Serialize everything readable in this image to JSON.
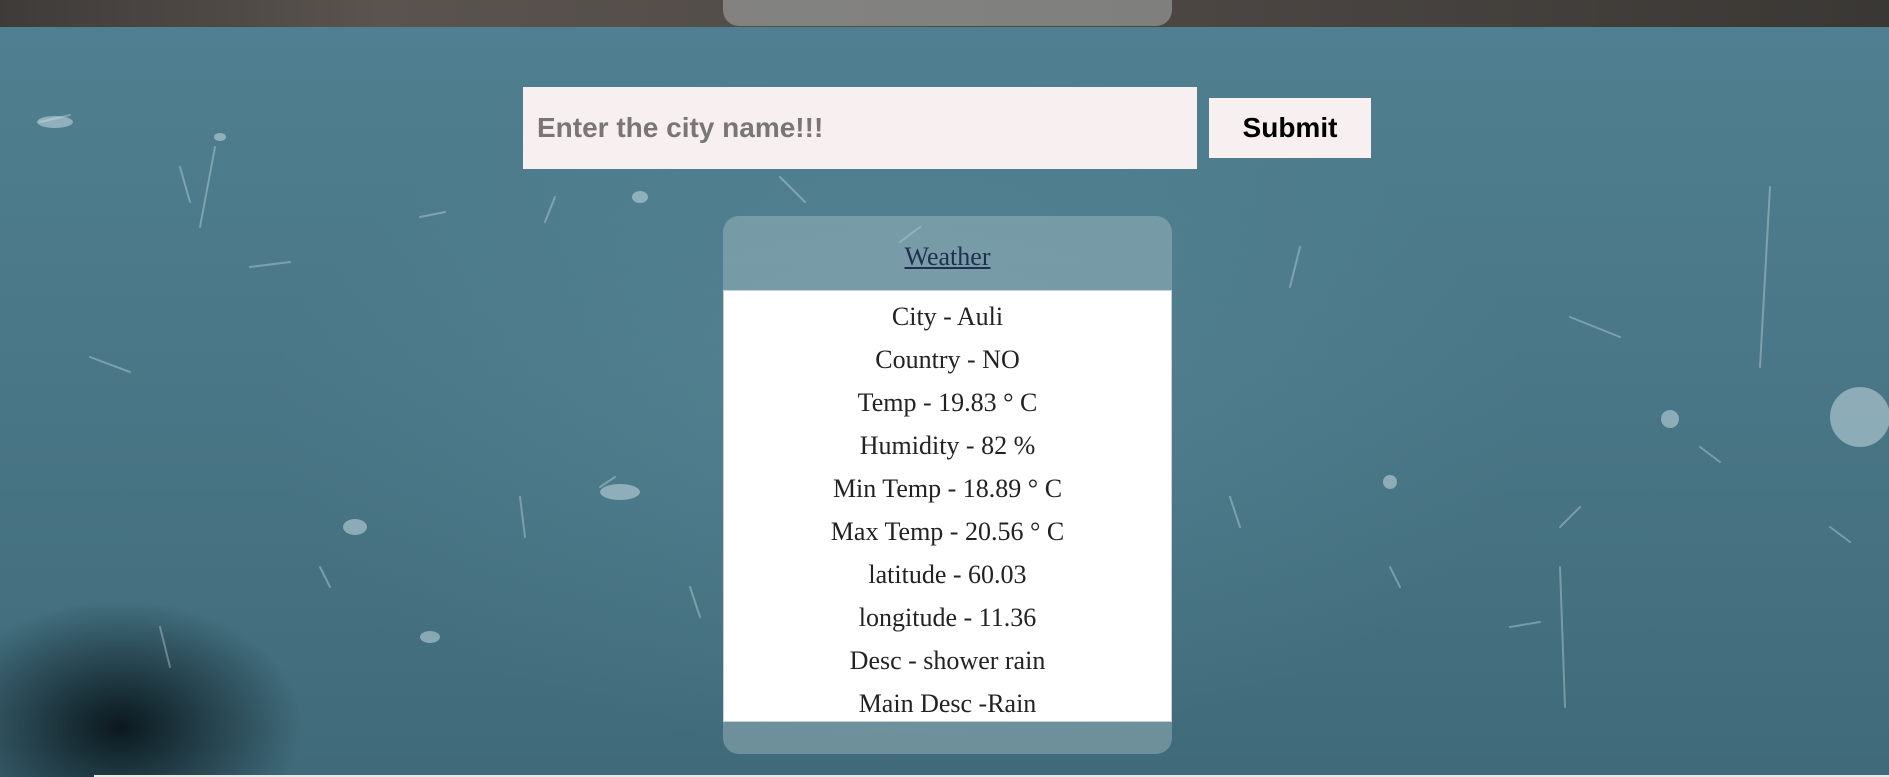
{
  "search": {
    "placeholder": "Enter the city name!!!",
    "value": "",
    "submit_label": "Submit"
  },
  "weather": {
    "title": "Weather",
    "items": [
      "City - Auli",
      "Country - NO",
      "Temp - 19.83 ° C",
      "Humidity - 82 %",
      "Min Temp - 18.89 ° C",
      "Max Temp - 20.56 ° C",
      "latitude - 60.03",
      "longitude - 11.36",
      "Desc - shower rain",
      "Main Desc -Rain"
    ]
  },
  "colors": {
    "background": "#4f7d8e",
    "input_bg": "#f7eff0",
    "card_overlay": "rgba(175,195,200,0.42)",
    "title_color": "#1f2f4f"
  }
}
